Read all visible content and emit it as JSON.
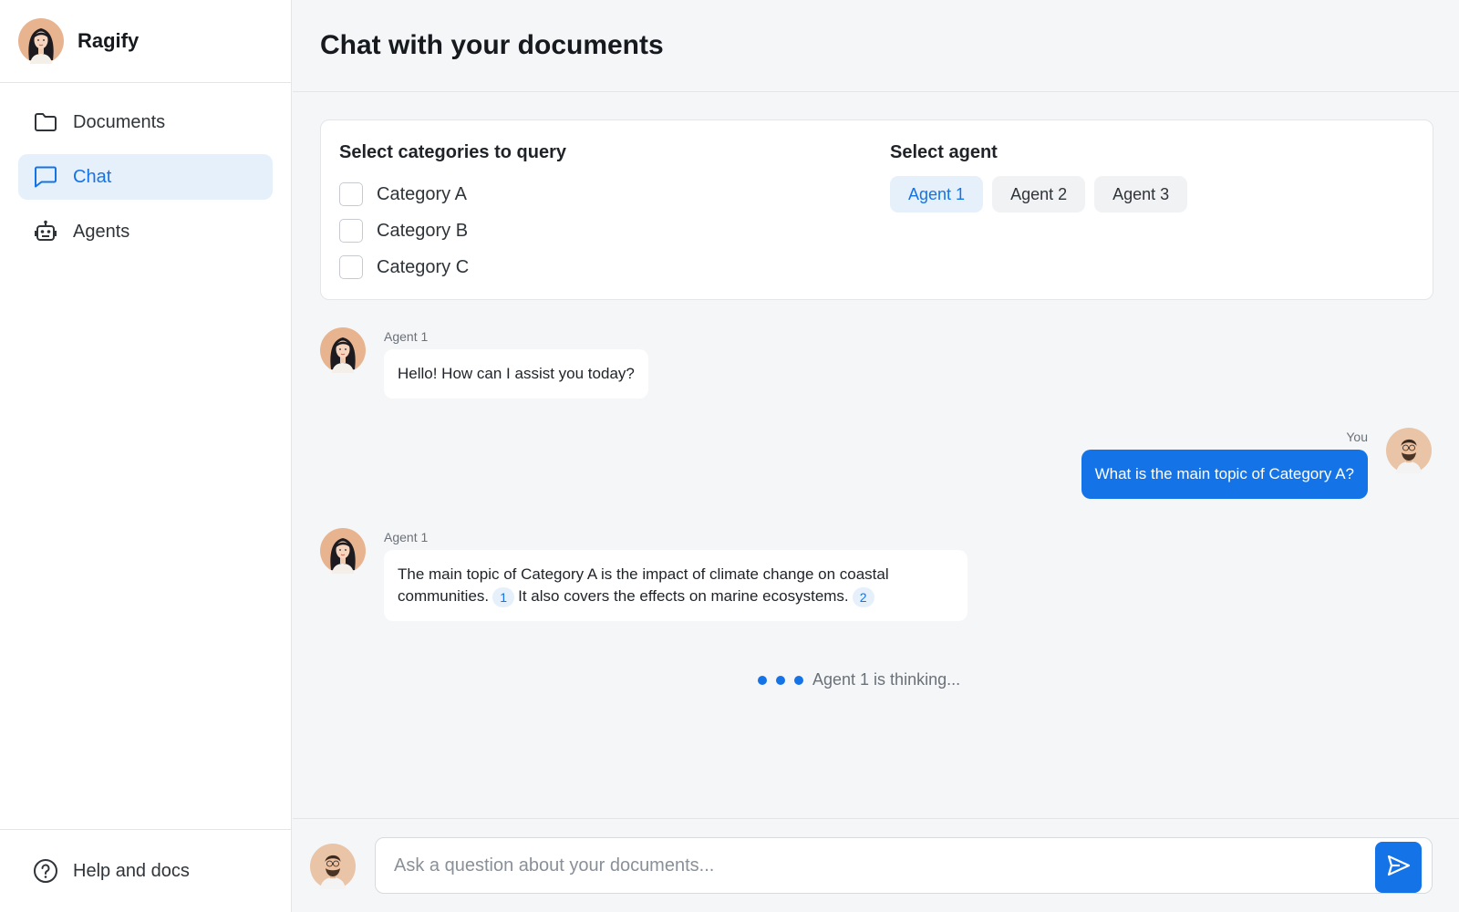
{
  "app": {
    "name": "Ragify"
  },
  "sidebar": {
    "items": [
      {
        "label": "Documents",
        "icon": "folder-icon",
        "active": false
      },
      {
        "label": "Chat",
        "icon": "chat-bubble-icon",
        "active": true
      },
      {
        "label": "Agents",
        "icon": "robot-icon",
        "active": false
      }
    ],
    "footer": {
      "label": "Help and docs",
      "icon": "help-circle-icon"
    }
  },
  "header": {
    "title": "Chat with your documents"
  },
  "panel": {
    "categories_heading": "Select categories to query",
    "categories": [
      {
        "label": "Category A",
        "checked": false
      },
      {
        "label": "Category B",
        "checked": false
      },
      {
        "label": "Category C",
        "checked": false
      }
    ],
    "agent_heading": "Select agent",
    "agents": [
      {
        "label": "Agent 1",
        "selected": true
      },
      {
        "label": "Agent 2",
        "selected": false
      },
      {
        "label": "Agent 3",
        "selected": false
      }
    ]
  },
  "messages": [
    {
      "role": "agent",
      "sender": "Agent 1",
      "text": "Hello! How can I assist you today?"
    },
    {
      "role": "user",
      "sender": "You",
      "text": "What is the main topic of Category A?"
    },
    {
      "role": "agent",
      "sender": "Agent 1",
      "text_part1": "The main topic of Category A is the impact of climate change on coastal communities.",
      "cite1": "1",
      "text_part2": "It also covers the effects on marine ecosystems.",
      "cite2": "2"
    }
  ],
  "status": {
    "thinking": "Agent 1 is thinking..."
  },
  "composer": {
    "placeholder": "Ask a question about your documents..."
  },
  "colors": {
    "accent": "#1473e6",
    "accent_light": "#e6f0fb",
    "agent_avatar_bg": "#e7b48f",
    "user_avatar_bg": "#e9c4a6"
  }
}
